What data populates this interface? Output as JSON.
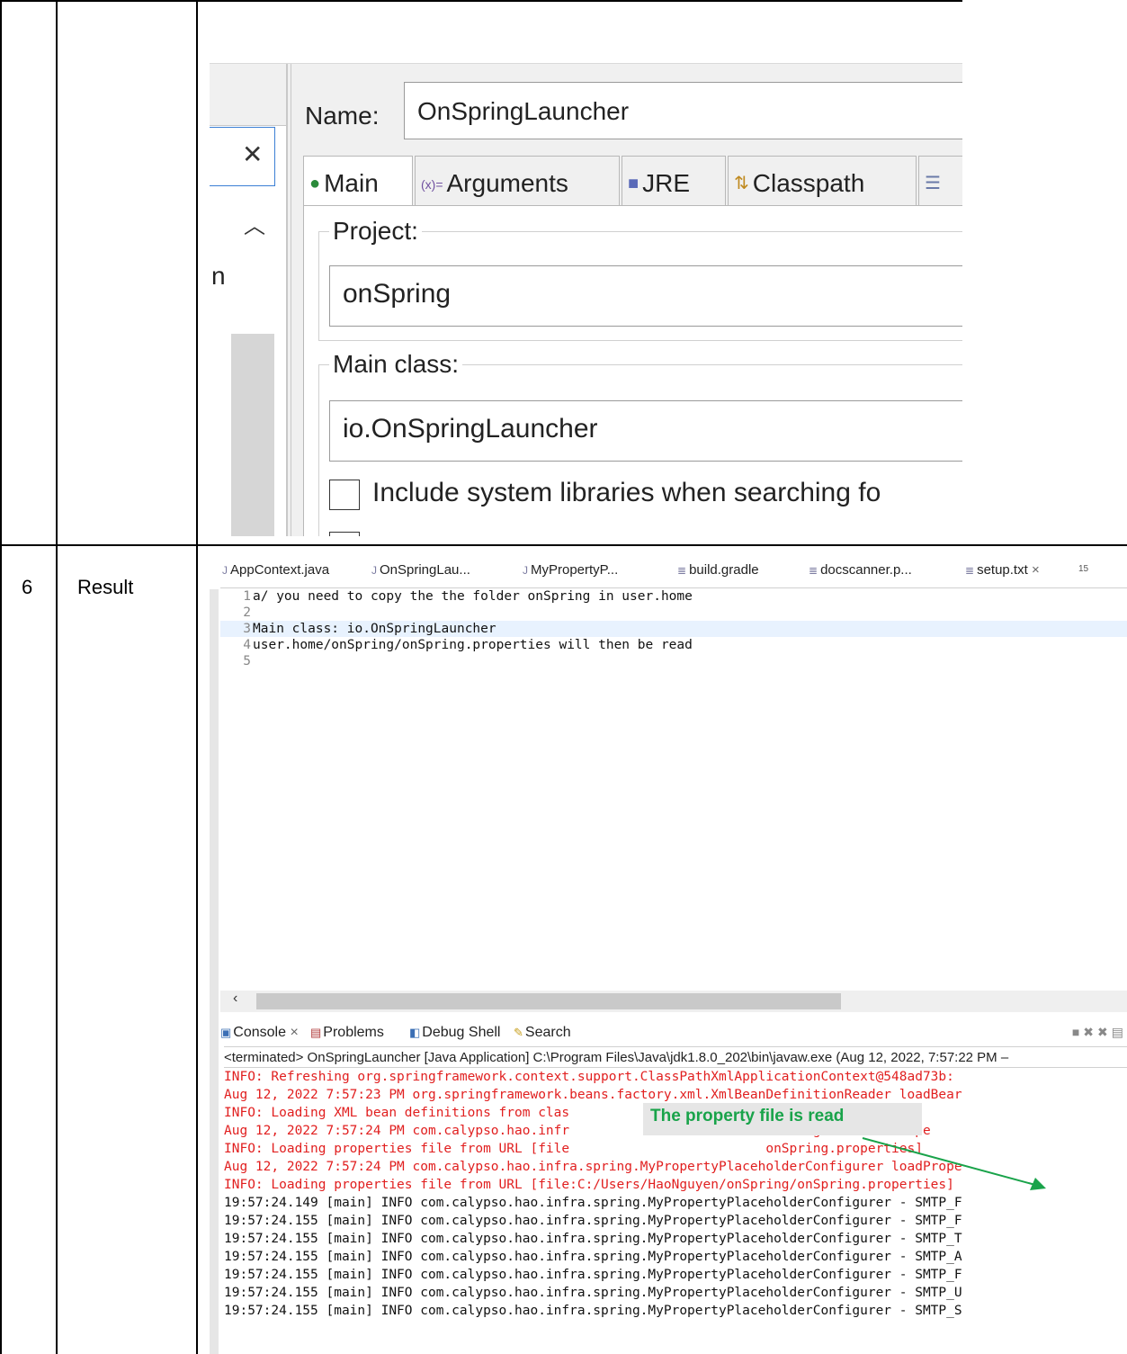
{
  "table": {
    "row_number": "6",
    "row_label": "Result"
  },
  "dialog": {
    "name_label": "Name:",
    "name_value": "OnSpringLauncher",
    "truncated_letter": "n",
    "tabs": [
      {
        "icon": "●",
        "label": "Main",
        "active": true
      },
      {
        "icon": "(x)=",
        "label": "Arguments"
      },
      {
        "icon": "■",
        "label": "JRE"
      },
      {
        "icon": "⇅",
        "label": "Classpath"
      }
    ],
    "project_label": "Project:",
    "project_value": "onSpring",
    "main_class_label": "Main class:",
    "main_class_value": "io.OnSpringLauncher",
    "checkbox_label": "Include system libraries when searching fo"
  },
  "editor": {
    "tabs": [
      "AppContext.java",
      "OnSpringLau...",
      "MyPropertyP...",
      "build.gradle",
      "docscanner.p...",
      "setup.txt"
    ],
    "tab_overflow": "15",
    "lines": [
      {
        "num": "1",
        "text": "a/ you need to copy the the folder onSpring in user.home"
      },
      {
        "num": "2",
        "text": ""
      },
      {
        "num": "3",
        "text": "Main class: io.OnSpringLauncher"
      },
      {
        "num": "4",
        "text": "user.home/onSpring/onSpring.properties will then be read"
      },
      {
        "num": "5",
        "text": ""
      }
    ]
  },
  "console": {
    "tabs": [
      "Console",
      "Problems",
      "Debug Shell",
      "Search"
    ],
    "terminated": "<terminated> OnSpringLauncher [Java Application] C:\\Program Files\\Java\\jdk1.8.0_202\\bin\\javaw.exe  (Aug 12, 2022, 7:57:22 PM –",
    "lines": [
      {
        "color": "red",
        "text": "INFO: Refreshing org.springframework.context.support.ClassPathXmlApplicationContext@548ad73b:"
      },
      {
        "color": "red",
        "text": "Aug 12, 2022 7:57:23 PM org.springframework.beans.factory.xml.XmlBeanDefinitionReader loadBear"
      },
      {
        "color": "red",
        "text": "INFO: Loading XML bean definitions from clas                         licationContext.xml]"
      },
      {
        "color": "red",
        "text": "Aug 12, 2022 7:57:24 PM com.calypso.hao.infr                         rConfigurer loadPrope"
      },
      {
        "color": "red",
        "text": "INFO: Loading properties file from URL [file                         onSpring.properties]"
      },
      {
        "color": "red",
        "text": "Aug 12, 2022 7:57:24 PM com.calypso.hao.infra.spring.MyPropertyPlaceholderConfigurer loadPrope"
      },
      {
        "color": "red",
        "text": "INFO: Loading properties file from URL [file:C:/Users/HaoNguyen/onSpring/onSpring.properties]"
      },
      {
        "color": "black",
        "text": "19:57:24.149 [main] INFO com.calypso.hao.infra.spring.MyPropertyPlaceholderConfigurer - SMTP_F"
      },
      {
        "color": "black",
        "text": "19:57:24.155 [main] INFO com.calypso.hao.infra.spring.MyPropertyPlaceholderConfigurer - SMTP_F"
      },
      {
        "color": "black",
        "text": "19:57:24.155 [main] INFO com.calypso.hao.infra.spring.MyPropertyPlaceholderConfigurer - SMTP_T"
      },
      {
        "color": "black",
        "text": "19:57:24.155 [main] INFO com.calypso.hao.infra.spring.MyPropertyPlaceholderConfigurer - SMTP_A"
      },
      {
        "color": "black",
        "text": "19:57:24.155 [main] INFO com.calypso.hao.infra.spring.MyPropertyPlaceholderConfigurer - SMTP_F"
      },
      {
        "color": "black",
        "text": "19:57:24.155 [main] INFO com.calypso.hao.infra.spring.MyPropertyPlaceholderConfigurer - SMTP_U"
      },
      {
        "color": "black",
        "text": "19:57:24.155 [main] INFO com.calypso.hao.infra.spring.MyPropertyPlaceholderConfigurer - SMTP_S"
      }
    ],
    "callout": "The property file is read",
    "colors": {
      "red": "#e11f1f",
      "black": "#111111",
      "callout_text": "#19a34a"
    }
  }
}
